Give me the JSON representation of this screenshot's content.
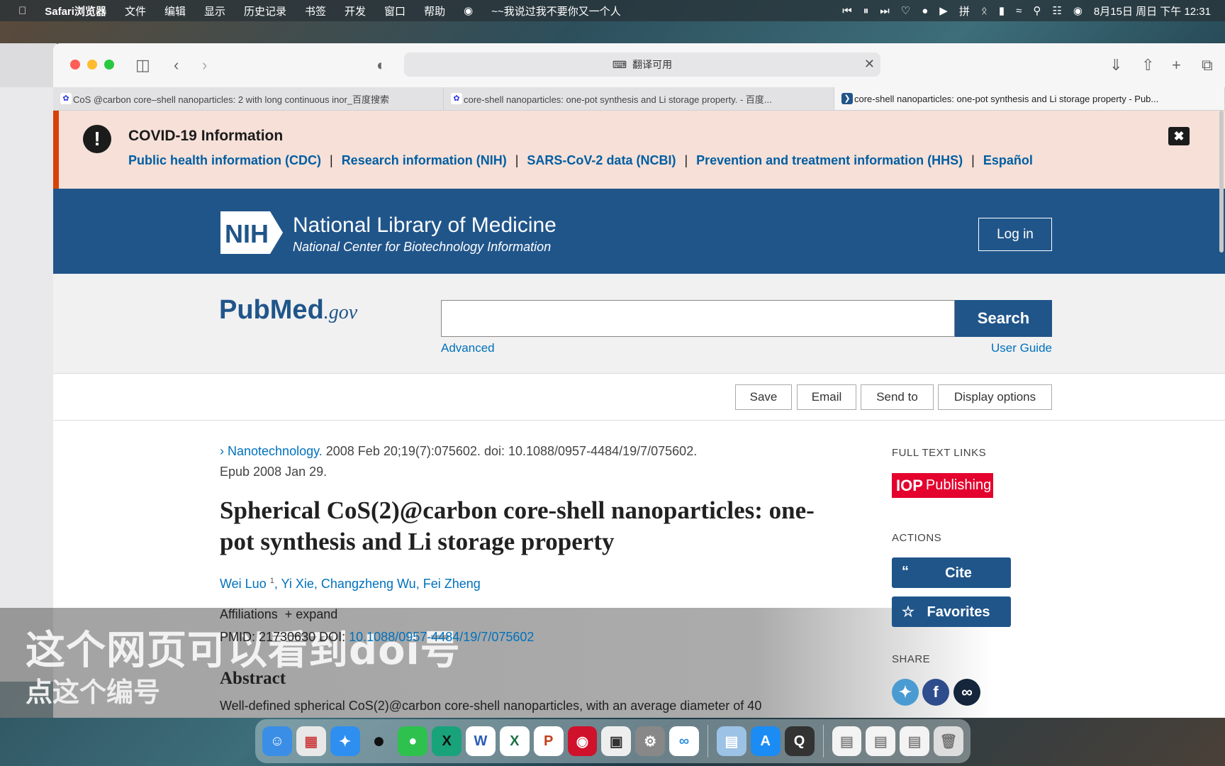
{
  "menubar": {
    "app": "Safari浏览器",
    "items": [
      "文件",
      "编辑",
      "显示",
      "历史记录",
      "书签",
      "开发",
      "窗口",
      "帮助"
    ],
    "now_playing": "~~我说过我不要你又一个人",
    "datetime": "8月15日 周日 下午 12:31"
  },
  "browser": {
    "address": "翻译可用",
    "tabs": [
      {
        "label": "CoS @carbon core–shell nanoparticles: 2 with long continuous inor_百度搜索"
      },
      {
        "label": "core-shell nanoparticles: one-pot synthesis and Li storage property. - 百度..."
      },
      {
        "label": "core-shell nanoparticles: one-pot synthesis and Li storage property - Pub..."
      }
    ]
  },
  "covid": {
    "title": "COVID-19 Information",
    "links": [
      "Public health information (CDC)",
      "Research information (NIH)",
      "SARS-CoV-2 data (NCBI)",
      "Prevention and treatment information (HHS)",
      "Español"
    ],
    "separator": "|"
  },
  "nih": {
    "logo_text": "NIH",
    "title": "National Library of Medicine",
    "subtitle": "National Center for Biotechnology Information",
    "login": "Log in"
  },
  "pubmed": {
    "logo_pub": "Pub",
    "logo_med": "Med",
    "logo_gov": ".gov",
    "search_value": "",
    "search_button": "Search",
    "advanced": "Advanced",
    "user_guide": "User Guide"
  },
  "actions_bar": {
    "save": "Save",
    "email": "Email",
    "send_to": "Send to",
    "display_options": "Display options"
  },
  "article": {
    "journal": "Nanotechnology.",
    "citation": " 2008 Feb 20;19(7):075602. doi: 10.1088/0957-4484/19/7/075602.",
    "epub": "Epub 2008 Jan 29.",
    "title": "Spherical CoS(2)@carbon core-shell nanoparticles: one-pot synthesis and Li storage property",
    "authors": [
      {
        "name": "Wei Luo",
        "sup": "1"
      },
      {
        "name": "Yi Xie"
      },
      {
        "name": "Changzheng Wu"
      },
      {
        "name": "Fei Zheng"
      }
    ],
    "affiliations": "Affiliations",
    "expand": "+ expand",
    "pmid_label": "PMID: 21730630",
    "doi_label": "DOI:",
    "doi": "10.1088/0957-4484/19/7/075602",
    "abstract_heading": "Abstract",
    "abstract_start": "Well-defined spherical CoS(2)@carbon core-shell nanoparticles, with an average diameter of 40"
  },
  "sidebar": {
    "full_text_links": "FULL TEXT LINKS",
    "publisher_bold": "IOP",
    "publisher_rest": "Publishing",
    "actions": "ACTIONS",
    "cite": "Cite",
    "favorites": "Favorites",
    "share": "SHARE"
  },
  "caption": {
    "line1": "这个网页可以看到doi号",
    "line2": "点这个编号"
  },
  "colors": {
    "nih_blue": "#20558a",
    "link_blue": "#0071bc",
    "covid_bg": "#f6e0d8",
    "iop_red": "#e4032e"
  }
}
